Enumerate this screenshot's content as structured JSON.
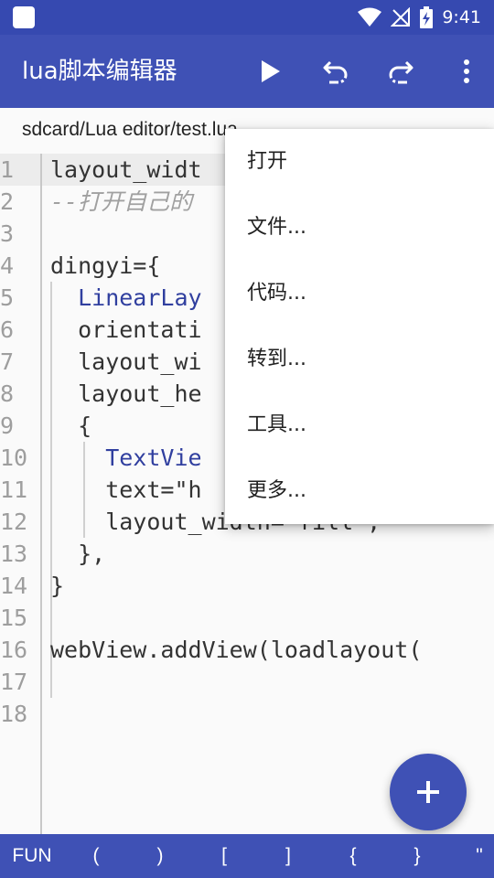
{
  "status_bar": {
    "time": "9:41"
  },
  "app_bar": {
    "title": "lua脚本编辑器",
    "icons": [
      "play-icon",
      "undo-icon",
      "redo-icon",
      "more-vert-icon"
    ]
  },
  "path": "sdcard/Lua editor/test.lua",
  "editor": {
    "line_numbers": [
      "1",
      "2",
      "3",
      "4",
      "5",
      "6",
      "7",
      "8",
      "9",
      "10",
      "11",
      "12",
      "13",
      "14",
      "15",
      "16",
      "17",
      "18"
    ],
    "lines": [
      "layout_widt",
      "--打开自己的",
      "",
      "dingyi={",
      "  LinearLay",
      "  orientati",
      "  layout_wi",
      "  layout_he",
      "  {",
      "    TextVie",
      "    text=\"h",
      "    layout_width=\"fill\",",
      "  },",
      "}",
      "",
      "webView.addView(loadlayout(",
      "",
      ""
    ]
  },
  "menu": {
    "items": [
      "打开",
      "文件...",
      "代码...",
      "转到...",
      "工具...",
      "更多..."
    ]
  },
  "fab": {
    "icon": "plus-icon"
  },
  "symbol_bar": {
    "items": [
      "FUN",
      "(",
      ")",
      "[",
      "]",
      "{",
      "}",
      "\""
    ]
  },
  "colors": {
    "primary": "#3f51b5",
    "primary_dark": "#3649b0",
    "keyword": "#303f9f",
    "comment": "#a0a0a0"
  }
}
